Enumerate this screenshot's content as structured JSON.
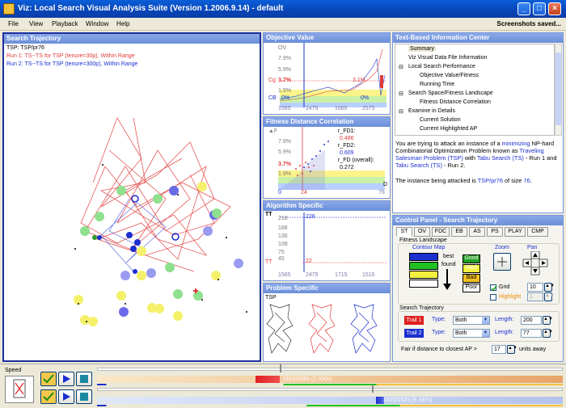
{
  "window": {
    "title": "Viz: Local Search Visual Analysis Suite (Version 1.2006.9.14) - default",
    "minimize": "_",
    "maximize": "□",
    "close": "×"
  },
  "menu": {
    "items": [
      "File",
      "View",
      "Playback",
      "Window",
      "Help"
    ],
    "status": "Screenshots saved..."
  },
  "search_trajectory": {
    "title": "Search Trajectory",
    "problem": "TSP: TSP/pr76",
    "run1": "Run 1: TS--TS for TSP (tenure=30p), Within Range",
    "run2": "Run 2: TS--TS for TSP (tenure=300p), Within Range",
    "colors": {
      "run1": "#e23b3b",
      "run2": "#1b2fd0"
    }
  },
  "objective_value": {
    "title": "Objective Value",
    "ylabels": [
      "OV",
      "9.9%",
      "7.9%",
      "5.9%",
      "3.7%",
      "1.9%",
      "0%"
    ],
    "cg_label": "Cg",
    "cg_pct": "3.7%",
    "right_pct": "3.1%",
    "cb_label": "CB",
    "cb_left": "0%",
    "cb_right": "0%",
    "xlabels": [
      "1565",
      "2475",
      "1665",
      "2575"
    ]
  },
  "fdc": {
    "title": "Fitness Distance Correlation",
    "ylabels": [
      "▲F",
      "9.9%",
      "7.9%",
      "5.9%",
      "3.7%",
      "1.9%",
      "0%"
    ],
    "rfd1_label": "r_FD1:",
    "rfd1": "0.486",
    "rfd2_label": "r_FD2:",
    "rfd2": "0.609",
    "rfd_label": "r_FD (overall):",
    "rfd": "0.272",
    "xlabels": [
      "0",
      "24",
      "76"
    ],
    "d_label": "D"
  },
  "algorithm_specific": {
    "title": "Algorithm Specific",
    "tt_label": "TT",
    "ylabels": [
      "218",
      "188",
      "136",
      "108",
      "75",
      "45",
      "16"
    ],
    "v1": "228",
    "v2": "22",
    "xlabels": [
      "1565",
      "2475",
      "1715",
      "1515"
    ]
  },
  "problem_specific": {
    "title": "Problem Specific",
    "label": "TSP"
  },
  "info_center": {
    "title": "Text-Based Information Center",
    "tree": [
      {
        "label": "Summary",
        "level": 0,
        "expander": ""
      },
      {
        "label": "Viz Visual Data File Information",
        "level": 0,
        "expander": ""
      },
      {
        "label": "Local Search Performance",
        "level": 0,
        "expander": "⊟"
      },
      {
        "label": "Objective Value/Fitness",
        "level": 1,
        "expander": ""
      },
      {
        "label": "Running Time",
        "level": 1,
        "expander": ""
      },
      {
        "label": "Search Space/Fitness Landscape",
        "level": 0,
        "expander": "⊟"
      },
      {
        "label": "Fitness Distance Correlation",
        "level": 1,
        "expander": ""
      },
      {
        "label": "Examine in Details",
        "level": 0,
        "expander": "⊟"
      },
      {
        "label": "Current Solution",
        "level": 1,
        "expander": ""
      },
      {
        "label": "Current Highlighted AP",
        "level": 1,
        "expander": ""
      }
    ],
    "p1_a": "You are trying to attack an instance of a ",
    "p1_link1": "minimizing",
    "p1_b": " NP-hard Combinatorial Optimization Problem known as ",
    "p1_link2": "Traveling Salesman Problem (TSP)",
    "p1_c": " with ",
    "p1_link3": "Tabu Search (TS)",
    "p1_d": " - Run 1 and ",
    "p1_link4": "Tabu Search (TS)",
    "p1_e": " - Run 2.",
    "p2_a": "The instance being attacked is ",
    "p2_link1": "TSP/pr76",
    "p2_b": " of size ",
    "p2_link2": "76",
    "p2_c": "."
  },
  "control_panel": {
    "title": "Control Panel - Search Trajectory",
    "tabs": [
      "ST",
      "OV",
      "FDC",
      "EB",
      "AS",
      "PS",
      "PLAY",
      "CMP"
    ],
    "fitness_landscape": "Fitness Landscape",
    "contour_map": "Contour Map",
    "best": "best",
    "found": "found",
    "grades": [
      "Good",
      "Med",
      "Bad",
      "Poor"
    ],
    "zoom": "Zoom",
    "pan": "Pan",
    "grid_label": "Grid",
    "grid_value": "10",
    "highlight_label": "Highlight",
    "highlight_value": "1",
    "search_trajectory": "Search Trajectory",
    "trail1": "Trail 1",
    "trail2": "Trail 2",
    "type_label": "Type:",
    "type1": "Both",
    "type2": "Both",
    "length_label": "Length:",
    "length1": "200",
    "length2": "77",
    "fair_label": "Fair if distance to closest AP >",
    "fair_value": "17",
    "units": "units away"
  },
  "playback": {
    "speed_label": "Speed",
    "progress1": "1615/2385 (2.500s)",
    "progress2": "2475/1525 (8.187s)",
    "fraction1": 0.6,
    "fraction2": 0.68
  }
}
